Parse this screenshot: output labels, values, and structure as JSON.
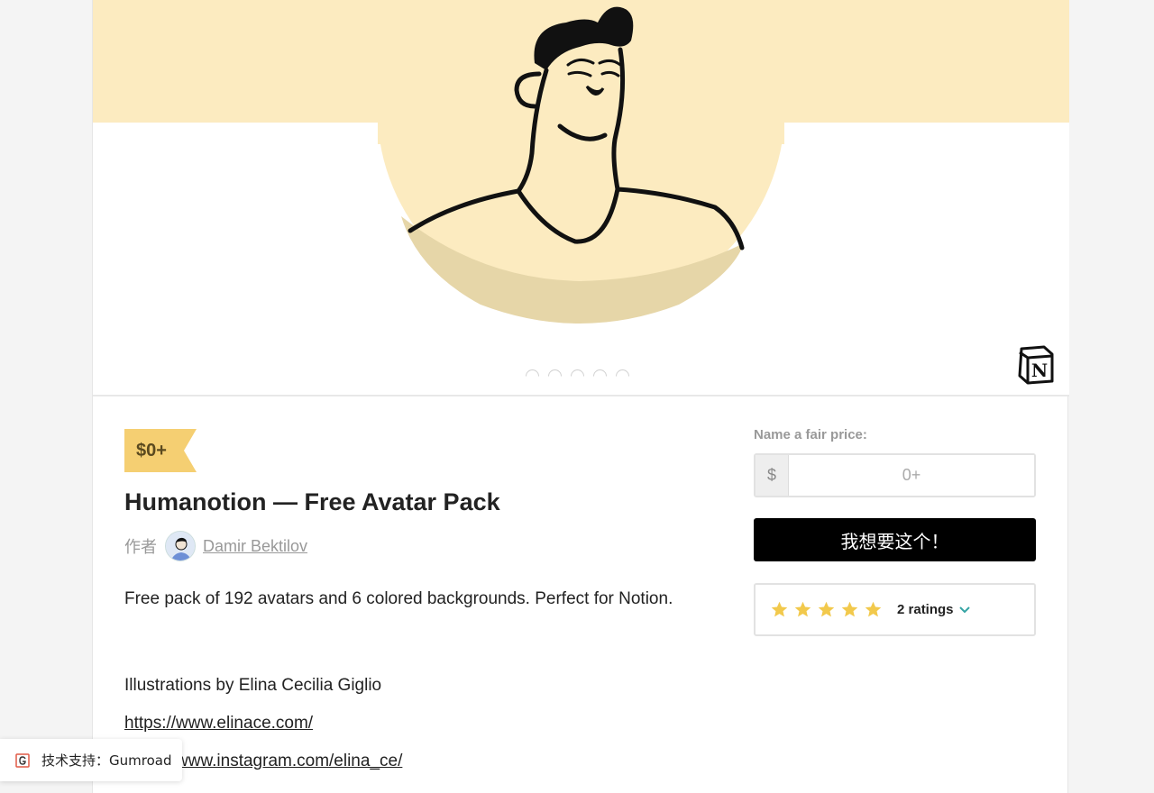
{
  "product": {
    "price_badge": "$0+",
    "title": "Humanotion — Free Avatar Pack",
    "byline_prefix": "作者",
    "author": "Damir Bektilov",
    "description": "Free pack of 192 avatars and 6 colored backgrounds. Perfect for Notion.",
    "credit": "Illustrations by Elina Cecilia Giglio",
    "link_website": "https://www.elinace.com/",
    "link_instagram": "https://www.instagram.com/elina_ce/"
  },
  "cover": {
    "image_count": 5,
    "notion_logo_letter": "N",
    "colors": {
      "background": "#fcebc0",
      "circle": "#fcebc0",
      "shadow": "#e6d6a8",
      "line": "#111111"
    }
  },
  "purchase": {
    "label": "Name a fair price:",
    "currency_symbol": "$",
    "price_placeholder": "0+",
    "buy_button": "我想要这个！"
  },
  "ratings": {
    "stars": 5,
    "rating_value": 5,
    "count_label": "2 ratings",
    "star_color": "#f2c94c",
    "chevron_color": "#35a4a4"
  },
  "footer_badge": {
    "label": "技术支持：Gumroad"
  },
  "theme": {
    "price_tag_color": "#f5cf72",
    "button_color": "#000000"
  }
}
